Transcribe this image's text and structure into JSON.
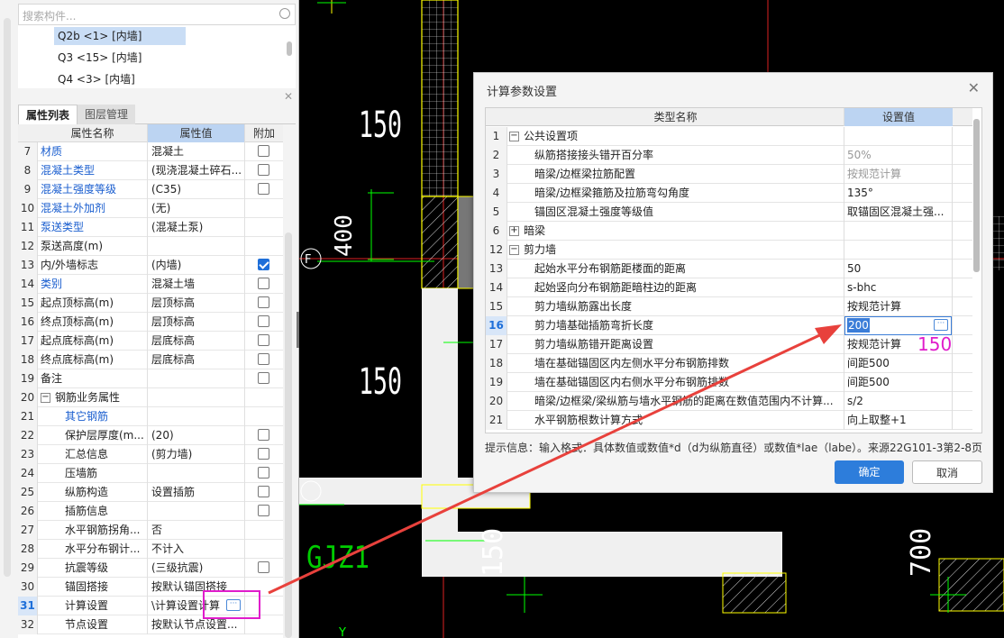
{
  "left_panel": {
    "search_placeholder": "搜索构件...",
    "tree_items": [
      {
        "label": "Q2b <1> [内墙]",
        "selected": true
      },
      {
        "label": "Q3 <15> [内墙]",
        "selected": false
      },
      {
        "label": "Q4 <3> [内墙]",
        "selected": false
      }
    ],
    "tabs": [
      "属性列表",
      "图层管理"
    ],
    "columns": {
      "name": "属性名称",
      "value": "属性值",
      "extra": "附加"
    },
    "rows": [
      {
        "n": "7",
        "name": "材质",
        "value": "混凝土",
        "blue": true,
        "cb": "off"
      },
      {
        "n": "8",
        "name": "混凝土类型",
        "value": "(现浇混凝土碎石...",
        "blue": true,
        "cb": "off"
      },
      {
        "n": "9",
        "name": "混凝土强度等级",
        "value": "(C35)",
        "blue": true,
        "cb": "off"
      },
      {
        "n": "10",
        "name": "混凝土外加剂",
        "value": "(无)",
        "blue": true,
        "cb": "none"
      },
      {
        "n": "11",
        "name": "泵送类型",
        "value": "(混凝土泵)",
        "blue": true,
        "cb": "none"
      },
      {
        "n": "12",
        "name": "泵送高度(m)",
        "value": "",
        "blue": false,
        "cb": "none"
      },
      {
        "n": "13",
        "name": "内/外墙标志",
        "value": "(内墙)",
        "blue": false,
        "cb": "on"
      },
      {
        "n": "14",
        "name": "类别",
        "value": "混凝土墙",
        "blue": true,
        "cb": "off"
      },
      {
        "n": "15",
        "name": "起点顶标高(m)",
        "value": "层顶标高",
        "blue": false,
        "cb": "off"
      },
      {
        "n": "16",
        "name": "终点顶标高(m)",
        "value": "层顶标高",
        "blue": false,
        "cb": "off"
      },
      {
        "n": "17",
        "name": "起点底标高(m)",
        "value": "层底标高",
        "blue": false,
        "cb": "off"
      },
      {
        "n": "18",
        "name": "终点底标高(m)",
        "value": "层底标高",
        "blue": false,
        "cb": "off"
      },
      {
        "n": "19",
        "name": "备注",
        "value": "",
        "blue": false,
        "cb": "off"
      },
      {
        "n": "20",
        "name": "钢筋业务属性",
        "value": "",
        "blue": false,
        "cb": "none",
        "group": true
      },
      {
        "n": "21",
        "name": "其它钢筋",
        "value": "",
        "blue": true,
        "cb": "none",
        "indent": true
      },
      {
        "n": "22",
        "name": "保护层厚度(m...",
        "value": "(20)",
        "blue": false,
        "cb": "off",
        "indent": true
      },
      {
        "n": "23",
        "name": "汇总信息",
        "value": "(剪力墙)",
        "blue": false,
        "cb": "off",
        "indent": true
      },
      {
        "n": "24",
        "name": "压墙筋",
        "value": "",
        "blue": false,
        "cb": "off",
        "indent": true
      },
      {
        "n": "25",
        "name": "纵筋构造",
        "value": "设置插筋",
        "blue": false,
        "cb": "off",
        "indent": true
      },
      {
        "n": "26",
        "name": "插筋信息",
        "value": "",
        "blue": false,
        "cb": "off",
        "indent": true
      },
      {
        "n": "27",
        "name": "水平钢筋拐角...",
        "value": "否",
        "blue": false,
        "cb": "none",
        "indent": true
      },
      {
        "n": "28",
        "name": "水平分布钢计...",
        "value": "不计入",
        "blue": false,
        "cb": "none",
        "indent": true
      },
      {
        "n": "29",
        "name": "抗震等级",
        "value": "(三级抗震)",
        "blue": false,
        "cb": "off",
        "indent": true
      },
      {
        "n": "30",
        "name": "锚固搭接",
        "value": "按默认锚固搭接",
        "blue": false,
        "cb": "none",
        "indent": true
      },
      {
        "n": "31",
        "name": "计算设置",
        "value": "\\计算设置计算",
        "blue": false,
        "cb": "none",
        "indent": true,
        "selected": true
      },
      {
        "n": "32",
        "name": "节点设置",
        "value": "按默认节点设置...",
        "blue": false,
        "cb": "none",
        "indent": true
      }
    ],
    "dots": "···"
  },
  "dialog": {
    "title": "计算参数设置",
    "close": "✕",
    "col_name": "类型名称",
    "col_value": "设置值",
    "rows": [
      {
        "n": "1",
        "name": "公共设置项",
        "value": "",
        "level": 0,
        "toggle": "−"
      },
      {
        "n": "2",
        "name": "纵筋搭接接头错开百分率",
        "value": "50%",
        "level": 1,
        "gray": true
      },
      {
        "n": "3",
        "name": "暗梁/边框梁拉筋配置",
        "value": "按规范计算",
        "level": 1,
        "gray": true
      },
      {
        "n": "4",
        "name": "暗梁/边框梁箍筋及拉筋弯勾角度",
        "value": "135°",
        "level": 1
      },
      {
        "n": "5",
        "name": "锚固区混凝土强度等级值",
        "value": "取锚固区混凝土强...",
        "level": 1
      },
      {
        "n": "6",
        "name": "暗梁",
        "value": "",
        "level": 0,
        "toggle": "+"
      },
      {
        "n": "12",
        "name": "剪力墙",
        "value": "",
        "level": 0,
        "toggle": "−"
      },
      {
        "n": "13",
        "name": "起始水平分布钢筋距楼面的距离",
        "value": "50",
        "level": 1
      },
      {
        "n": "14",
        "name": "起始竖向分布钢筋距暗柱边的距离",
        "value": "s-bhc",
        "level": 1
      },
      {
        "n": "15",
        "name": "剪力墙纵筋露出长度",
        "value": "按规范计算",
        "level": 1
      },
      {
        "n": "16",
        "name": "剪力墙基础插筋弯折长度",
        "value": "200",
        "level": 1,
        "editing": true
      },
      {
        "n": "17",
        "name": "剪力墙纵筋错开距离设置",
        "value": "按规范计算",
        "level": 1
      },
      {
        "n": "18",
        "name": "墙在基础锚固区内左侧水平分布钢筋排数",
        "value": "间距500",
        "level": 1
      },
      {
        "n": "19",
        "name": "墙在基础锚固区内右侧水平分布钢筋排数",
        "value": "间距500",
        "level": 1
      },
      {
        "n": "20",
        "name": "暗梁/边框梁/梁纵筋与墙水平钢筋的距离在数值范围内不计算...",
        "value": "s/2",
        "level": 1
      },
      {
        "n": "21",
        "name": "水平钢筋根数计算方式",
        "value": "向上取整+1",
        "level": 1
      }
    ],
    "tip": "提示信息：输入格式：具体数值或数值*d（d为纵筋直径）或数值*lae（labe）。来源22G101-3第2-8页",
    "ok": "确定",
    "cancel": "取消"
  },
  "annotation": {
    "text": "150",
    "color": "#e01ccb",
    "arrow_color": "#e8413c"
  },
  "cad": {
    "dims": [
      "150",
      "400",
      "150",
      "150",
      "700"
    ],
    "axis_label": "F",
    "wall_label": "GJZ1",
    "y_label": "Y"
  }
}
